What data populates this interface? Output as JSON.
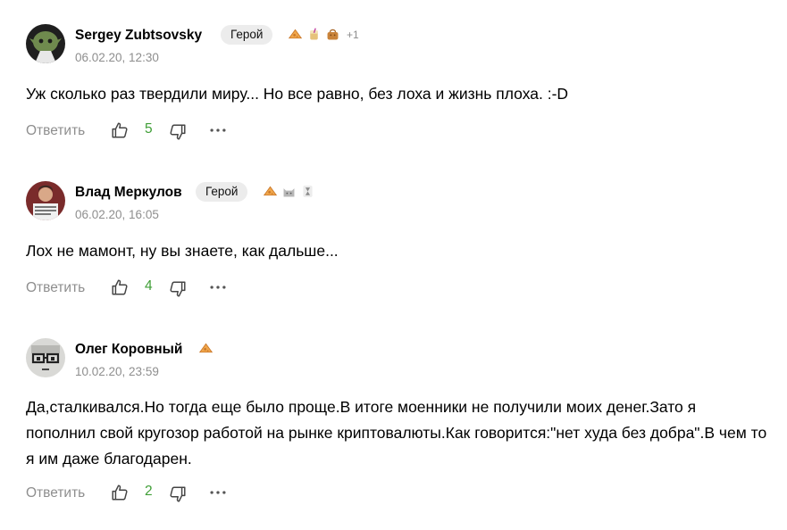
{
  "ui": {
    "reply_label": "Ответить",
    "like_icon": "thumbs-up-icon",
    "dislike_icon": "thumbs-down-icon",
    "more_icon": "more-dots-icon",
    "accent_count_color": "#3f9e36"
  },
  "comments": [
    {
      "author": "Sergey Zubtsovsky",
      "badge": "Герой",
      "awards": [
        "cheese-icon",
        "drink-icon",
        "bag-icon"
      ],
      "awards_more": "+1",
      "date": "06.02.20, 12:30",
      "text": "Уж сколько раз твердили миру... Но все равно, без лоха и жизнь плоха. :-D",
      "likes": "5"
    },
    {
      "author": "Влад Меркулов",
      "badge": "Герой",
      "awards": [
        "cheese-icon",
        "cat-icon",
        "hourglass-icon"
      ],
      "date": "06.02.20, 16:05",
      "text": "Лох не мамонт, ну вы знаете, как дальше...",
      "likes": "4"
    },
    {
      "author": "Олег Коровный",
      "awards": [
        "cheese-icon"
      ],
      "date": "10.02.20, 23:59",
      "text": "Да,сталкивался.Но тогда еще было проще.В итоге моенники не получили моих денег.Зато я пополнил свой кругозор работой на рынке криптовалюты.Как говорится:\"нет худа без добра\".В чем то я им даже благодарен.",
      "likes": "2"
    }
  ]
}
